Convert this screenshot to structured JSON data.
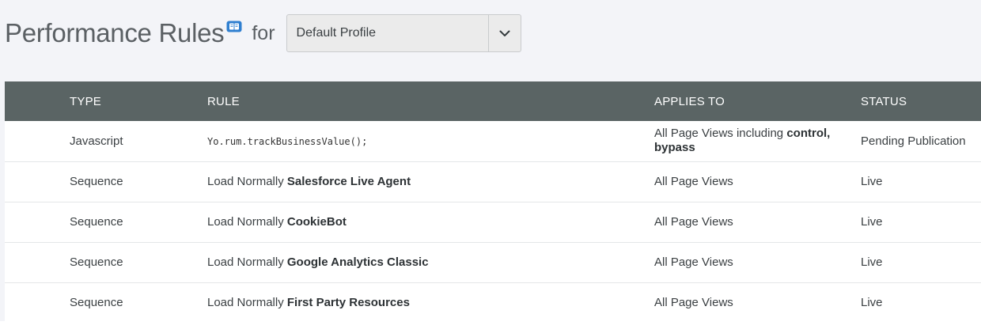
{
  "header": {
    "title": "Performance Rules",
    "for_label": "for",
    "docs_icon": "book-icon",
    "profile_select": {
      "value": "Default Profile",
      "arrow_icon": "chevron-down-icon"
    }
  },
  "table": {
    "columns": {
      "type": "TYPE",
      "rule": "RULE",
      "applies_to": "APPLIES TO",
      "status": "STATUS"
    },
    "rows": [
      {
        "type": "Javascript",
        "rule_code": "Yo.rum.trackBusinessValue();",
        "applies_prefix": "All Page Views including ",
        "applies_bold": "control, bypass",
        "status": "Pending Publication"
      },
      {
        "type": "Sequence",
        "rule_prefix": "Load Normally ",
        "rule_bold": "Salesforce Live Agent",
        "applies_to": "All Page Views",
        "status": "Live"
      },
      {
        "type": "Sequence",
        "rule_prefix": "Load Normally ",
        "rule_bold": "CookieBot",
        "applies_to": "All Page Views",
        "status": "Live"
      },
      {
        "type": "Sequence",
        "rule_prefix": "Load Normally ",
        "rule_bold": "Google Analytics Classic",
        "applies_to": "All Page Views",
        "status": "Live"
      },
      {
        "type": "Sequence",
        "rule_prefix": "Load Normally ",
        "rule_bold": "First Party Resources",
        "applies_to": "All Page Views",
        "status": "Live"
      }
    ]
  },
  "colors": {
    "page_background": "#f3f4f8",
    "table_header": "#5a6464",
    "docs_icon": "#2f7fd0"
  }
}
